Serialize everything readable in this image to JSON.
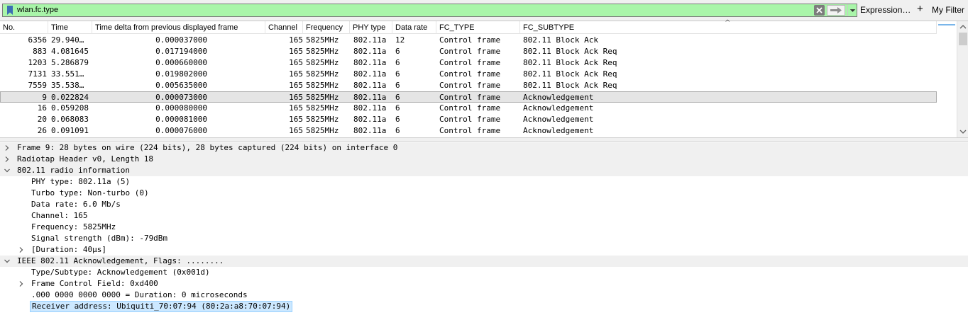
{
  "filter": {
    "value": "wlan.fc.type",
    "expression_label": "Expression…",
    "add_label": "+",
    "my_filter_label": "My Filter"
  },
  "packet_list": {
    "headers": [
      "No.",
      "Time",
      "Time delta from previous displayed frame",
      "Channel",
      "Frequency",
      "PHY type",
      "Data rate",
      "FC_TYPE",
      "FC_SUBTYPE"
    ],
    "sort_indicator": "^",
    "selected_index": 5,
    "rows": [
      [
        "6356",
        "29.940…",
        "0.000037000",
        "165",
        "5825MHz",
        "802.11a",
        "12",
        "Control frame",
        "802.11 Block Ack"
      ],
      [
        "883",
        "4.081645",
        "0.017194000",
        "165",
        "5825MHz",
        "802.11a",
        "6",
        "Control frame",
        "802.11 Block Ack Req"
      ],
      [
        "1203",
        "5.286879",
        "0.000660000",
        "165",
        "5825MHz",
        "802.11a",
        "6",
        "Control frame",
        "802.11 Block Ack Req"
      ],
      [
        "7131",
        "33.551…",
        "0.019802000",
        "165",
        "5825MHz",
        "802.11a",
        "6",
        "Control frame",
        "802.11 Block Ack Req"
      ],
      [
        "7559",
        "35.538…",
        "0.005635000",
        "165",
        "5825MHz",
        "802.11a",
        "6",
        "Control frame",
        "802.11 Block Ack Req"
      ],
      [
        "9",
        "0.022824",
        "0.000073000",
        "165",
        "5825MHz",
        "802.11a",
        "6",
        "Control frame",
        "Acknowledgement"
      ],
      [
        "16",
        "0.059208",
        "0.000080000",
        "165",
        "5825MHz",
        "802.11a",
        "6",
        "Control frame",
        "Acknowledgement"
      ],
      [
        "20",
        "0.068083",
        "0.000081000",
        "165",
        "5825MHz",
        "802.11a",
        "6",
        "Control frame",
        "Acknowledgement"
      ],
      [
        "26",
        "0.091091",
        "0.000076000",
        "165",
        "5825MHz",
        "802.11a",
        "6",
        "Control frame",
        "Acknowledgement"
      ]
    ]
  },
  "details": [
    {
      "text": "Frame 9: 28 bytes on wire (224 bits), 28 bytes captured (224 bits) on interface 0",
      "level": 0,
      "expander": "collapsed"
    },
    {
      "text": "Radiotap Header v0, Length 18",
      "level": 0,
      "expander": "collapsed"
    },
    {
      "text": "802.11 radio information",
      "level": 0,
      "expander": "expanded"
    },
    {
      "text": "PHY type: 802.11a (5)",
      "level": 1,
      "expander": "none"
    },
    {
      "text": "Turbo type: Non-turbo (0)",
      "level": 1,
      "expander": "none"
    },
    {
      "text": "Data rate: 6.0 Mb/s",
      "level": 1,
      "expander": "none"
    },
    {
      "text": "Channel: 165",
      "level": 1,
      "expander": "none"
    },
    {
      "text": "Frequency: 5825MHz",
      "level": 1,
      "expander": "none"
    },
    {
      "text": "Signal strength (dBm): -79dBm",
      "level": 1,
      "expander": "none"
    },
    {
      "text": "[Duration: 40μs]",
      "level": 1,
      "expander": "collapsed"
    },
    {
      "text": "IEEE 802.11 Acknowledgement, Flags: ........",
      "level": 0,
      "expander": "expanded"
    },
    {
      "text": "Type/Subtype: Acknowledgement (0x001d)",
      "level": 1,
      "expander": "none"
    },
    {
      "text": "Frame Control Field: 0xd400",
      "level": 1,
      "expander": "collapsed"
    },
    {
      "text": ".000 0000 0000 0000 = Duration: 0 microseconds",
      "level": 1,
      "expander": "none"
    },
    {
      "text": "Receiver address: Ubiquiti_70:07:94 (80:2a:a8:70:07:94)",
      "level": 1,
      "expander": "none",
      "selected": true
    }
  ],
  "colors": {
    "filter_valid": "#a9f5a9",
    "selected_row": "#e5e5e5",
    "selected_field": "#cce8ff"
  }
}
